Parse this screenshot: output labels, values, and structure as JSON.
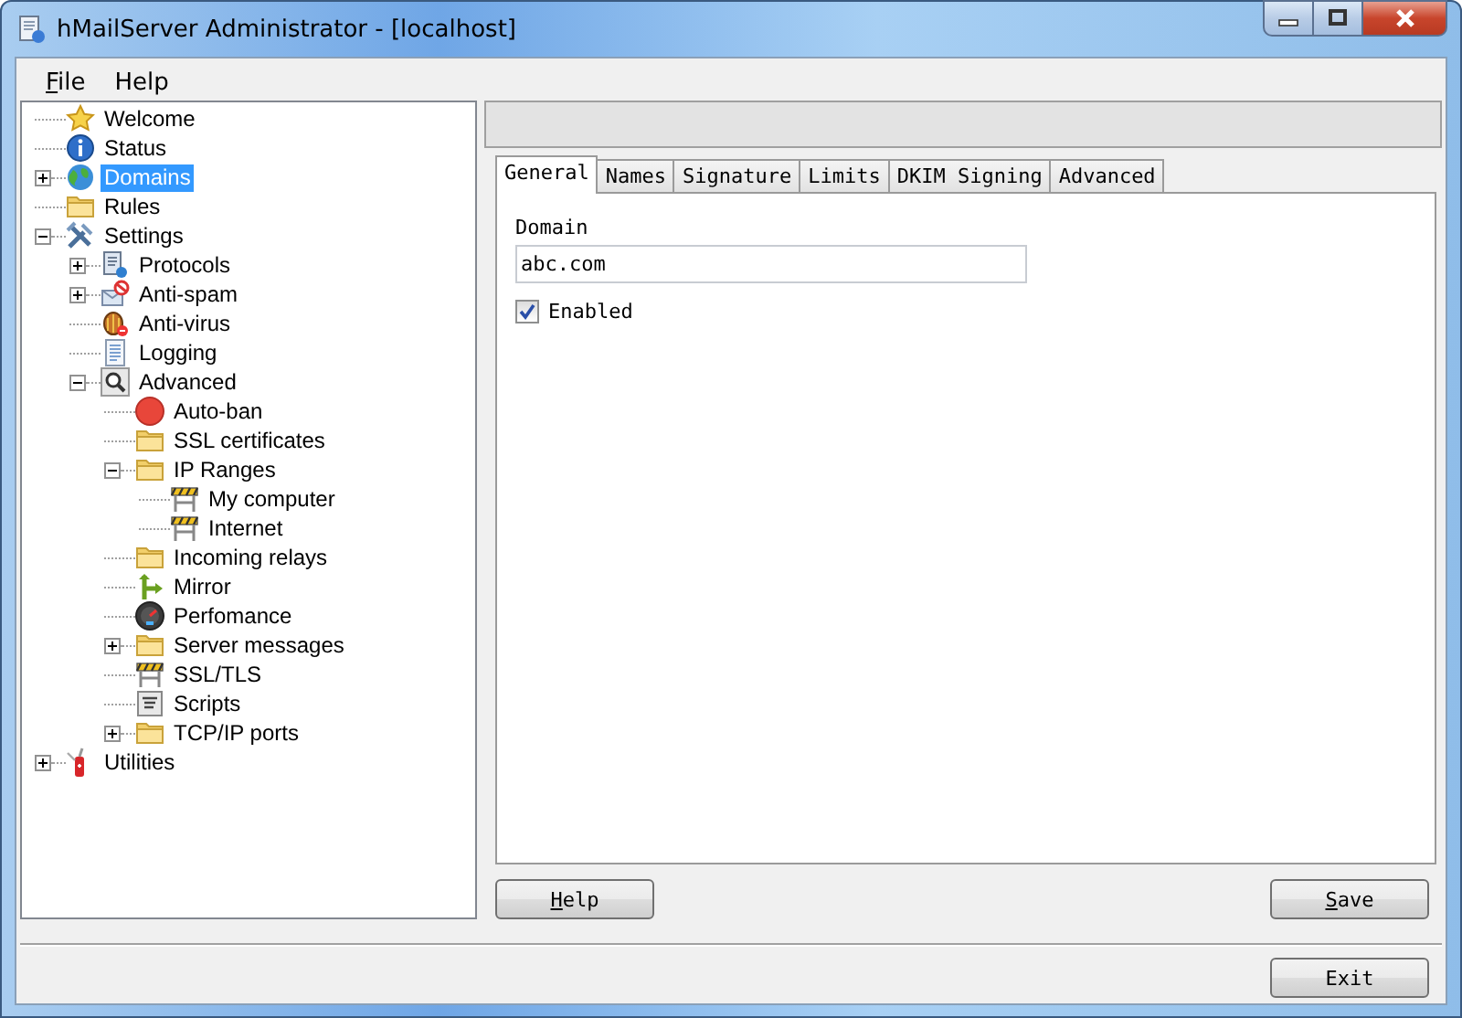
{
  "window": {
    "title": "hMailServer Administrator - [localhost]"
  },
  "menu": [
    {
      "label": "File",
      "underline_first": true
    },
    {
      "label": "Help",
      "underline_first": false
    }
  ],
  "tree": [
    {
      "label": "Welcome",
      "kind": "star",
      "selected": false
    },
    {
      "label": "Status",
      "kind": "info",
      "selected": false
    },
    {
      "label": "Domains",
      "kind": "globe",
      "selected": true,
      "expanded": false
    },
    {
      "label": "Rules",
      "kind": "folder",
      "selected": false
    },
    {
      "label": "Settings",
      "kind": "tools",
      "selected": false,
      "expanded": true,
      "children": [
        {
          "label": "Protocols",
          "kind": "protocol",
          "selected": false,
          "expanded": false
        },
        {
          "label": "Anti-spam",
          "kind": "antispam",
          "selected": false,
          "expanded": false
        },
        {
          "label": "Anti-virus",
          "kind": "bug",
          "selected": false
        },
        {
          "label": "Logging",
          "kind": "log",
          "selected": false
        },
        {
          "label": "Advanced",
          "kind": "magnifier",
          "selected": false,
          "expanded": true,
          "children": [
            {
              "label": "Auto-ban",
              "kind": "stop",
              "selected": false
            },
            {
              "label": "SSL certificates",
              "kind": "folder",
              "selected": false
            },
            {
              "label": "IP Ranges",
              "kind": "folder",
              "selected": false,
              "expanded": true,
              "children": [
                {
                  "label": "My computer",
                  "kind": "barrier",
                  "selected": false
                },
                {
                  "label": "Internet",
                  "kind": "barrier",
                  "selected": false
                }
              ]
            },
            {
              "label": "Incoming relays",
              "kind": "folder",
              "selected": false
            },
            {
              "label": "Mirror",
              "kind": "mirror",
              "selected": false
            },
            {
              "label": "Perfomance",
              "kind": "gauge",
              "selected": false
            },
            {
              "label": "Server messages",
              "kind": "folder",
              "selected": false,
              "expanded": false
            },
            {
              "label": "SSL/TLS",
              "kind": "barrier",
              "selected": false
            },
            {
              "label": "Scripts",
              "kind": "script",
              "selected": false
            },
            {
              "label": "TCP/IP ports",
              "kind": "folder",
              "selected": false,
              "expanded": false
            }
          ]
        }
      ]
    },
    {
      "label": "Utilities",
      "kind": "knife",
      "selected": false,
      "expanded": false
    }
  ],
  "tabs": [
    {
      "label": "General",
      "selected": true
    },
    {
      "label": "Names",
      "selected": false
    },
    {
      "label": "Signature",
      "selected": false
    },
    {
      "label": "Limits",
      "selected": false
    },
    {
      "label": "DKIM Signing",
      "selected": false
    },
    {
      "label": "Advanced",
      "selected": false
    }
  ],
  "form": {
    "domain_label": "Domain",
    "domain_value": "abc.com",
    "enabled": {
      "label": "Enabled",
      "checked": true
    }
  },
  "buttons": {
    "help": {
      "label": "Help",
      "underline_first": true
    },
    "save": {
      "label": "Save",
      "underline_first": true
    },
    "exit": {
      "label": "Exit",
      "underline_first": false
    }
  }
}
